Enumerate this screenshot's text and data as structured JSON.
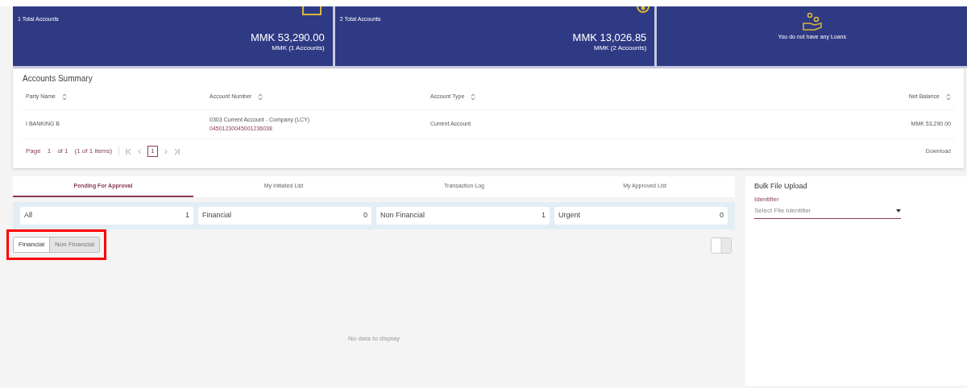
{
  "cards": [
    {
      "kind": "balance",
      "caption": "1 Total Accounts",
      "amount": "MMK 53,290.00",
      "sub": "MMK (1 Accounts)"
    },
    {
      "kind": "balance",
      "caption": "2 Total Accounts",
      "amount": "MMK 13,026.85",
      "sub": "MMK (2 Accounts)"
    },
    {
      "kind": "empty",
      "message": "You do not have any Loans"
    }
  ],
  "summary": {
    "title": "Accounts Summary",
    "columns": [
      "Party Name",
      "Account Number",
      "Account Type",
      "Net Balance"
    ],
    "rows": [
      {
        "party": "I BANKING B",
        "account_name": "0303 Current Account - Company (LCY)",
        "account_number": "04501230045001236038",
        "type": "Current Account",
        "balance": "MMK 53,290.00"
      }
    ],
    "pager": {
      "label": "Page",
      "page": "1",
      "of": "of 1",
      "items": "(1 of 1 items)",
      "current": "1"
    },
    "download": "Download"
  },
  "tabs": [
    {
      "label": "Pending For Approval",
      "selected": true
    },
    {
      "label": "My Initiated List",
      "selected": false
    },
    {
      "label": "Transaction Log",
      "selected": false
    },
    {
      "label": "My Approved List",
      "selected": false
    }
  ],
  "filters": [
    {
      "label": "All",
      "count": "1"
    },
    {
      "label": "Financial",
      "count": "0"
    },
    {
      "label": "Non Financial",
      "count": "1"
    },
    {
      "label": "Urgent",
      "count": "0"
    }
  ],
  "toggle": [
    {
      "label": "Financial",
      "selected": true
    },
    {
      "label": "Non Financial",
      "selected": false
    }
  ],
  "empty_message": "No data to display",
  "bulk": {
    "title": "Bulk File Upload",
    "field_label": "Identifier",
    "placeholder": "Select File Identifier"
  }
}
